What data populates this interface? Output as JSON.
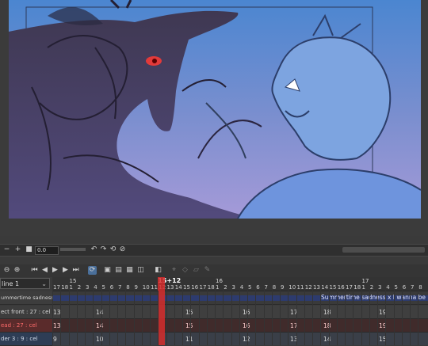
{
  "navigator": {
    "zoom_value": "0.0",
    "buttons": [
      "−",
      "+",
      "■"
    ],
    "rotate_buttons": [
      "↶",
      "↷",
      "⟲",
      "⊘"
    ]
  },
  "toolbar": {
    "icons": [
      "zoom-out-icon",
      "zoom-in-icon",
      "first-frame-icon",
      "prev-frame-icon",
      "play-icon",
      "next-frame-icon",
      "last-frame-icon",
      "loop-icon",
      "new-cel-icon",
      "new-animation-folder-icon",
      "specify-cel-icon",
      "onion-skin-icon",
      "light-table-icon",
      "pencil-icon"
    ]
  },
  "timeline": {
    "selector_value": "line 1",
    "playhead": "15+12",
    "seconds": [
      "15",
      "16",
      "17"
    ],
    "frame_ticks": [
      "17",
      "18",
      "1",
      "2",
      "3",
      "4",
      "5",
      "6",
      "7",
      "8",
      "9",
      "10",
      "11",
      "12",
      "13",
      "14",
      "15",
      "16",
      "17",
      "18",
      "1",
      "2",
      "3",
      "4",
      "5",
      "6",
      "7",
      "8",
      "9",
      "10",
      "11",
      "12",
      "13",
      "14",
      "15",
      "16",
      "17",
      "18",
      "1",
      "2",
      "3",
      "4",
      "5",
      "6",
      "7",
      "8"
    ],
    "tracks": [
      {
        "label": "ummertime sadness x I wann"
      },
      {
        "label": "ect front : 27 : cel"
      },
      {
        "label": "ead : 27 : cel"
      },
      {
        "label": "der 3 : 9 : cel"
      }
    ],
    "audio_title": "Summertime sadness x I wanna be",
    "row1_cels": [
      "13",
      "14",
      "15",
      "16",
      "17",
      "18",
      "19"
    ],
    "row2_cels": [
      "13",
      "14",
      "15",
      "16",
      "17",
      "18",
      "19"
    ],
    "row3_cels": [
      "9",
      "10",
      "11",
      "12",
      "13",
      "14",
      "15"
    ]
  },
  "colors": {
    "playhead": "#d62d2d",
    "audio_track": "#2d3b6e",
    "selected_track": "#2e3d55",
    "active_track": "#5a2b2b"
  }
}
